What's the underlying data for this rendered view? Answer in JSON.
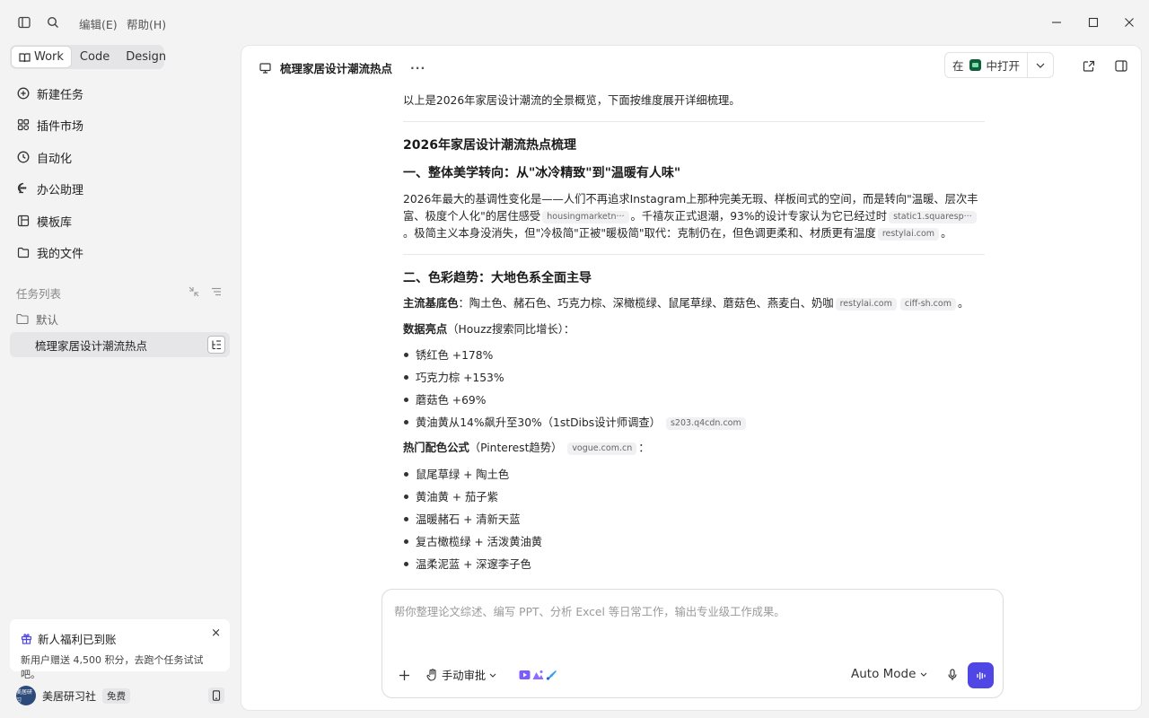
{
  "menu": {
    "edit": "编辑(E)",
    "help": "帮助(H)"
  },
  "modes": [
    {
      "label": "Work",
      "active": true
    },
    {
      "label": "Code",
      "active": false
    },
    {
      "label": "Design",
      "active": false
    }
  ],
  "nav": [
    {
      "label": "新建任务",
      "icon": "new-task-icon"
    },
    {
      "label": "插件市场",
      "icon": "plugin-icon"
    },
    {
      "label": "自动化",
      "icon": "clock-icon"
    },
    {
      "label": "办公助理",
      "icon": "chat-icon"
    },
    {
      "label": "模板库",
      "icon": "template-icon"
    },
    {
      "label": "我的文件",
      "icon": "folder-icon"
    }
  ],
  "tasks": {
    "section": "任务列表",
    "folder": "默认",
    "active_task": "梳理家居设计潮流热点"
  },
  "promo": {
    "title": "新人福利已到账",
    "subtitle": "新用户赠送 4,500 积分，去跑个任务试试吧。",
    "close": "×"
  },
  "user": {
    "name": "美居研习社",
    "plan": "免费",
    "avatar_text": "美居研习"
  },
  "header": {
    "title": "梳理家居设计潮流热点",
    "dots": "···",
    "open_prefix": "在",
    "open_label": "中打开"
  },
  "content": {
    "intro": "以上是2026年家居设计潮流的全景概览，下面按维度展开详细梳理。",
    "title": "2026年家居设计潮流热点梳理",
    "s1_heading": "一、整体美学转向：从\"冰冷精致\"到\"温暖有人味\"",
    "s1_p1": "2026年最大的基调性变化是——人们不再追求Instagram上那种完美无瑕、样板间式的空间，而是转向\"温暖、层次丰富、极度个人化\"的居住感受",
    "s1_cite1": "housingmarketn···",
    "s1_p2": "。千禧灰正式退潮，93%的设计专家认为它已经过时",
    "s1_cite2": "static1.squaresp···",
    "s1_p3": "。极简主义本身没消失，但\"冷极简\"正被\"暖极简\"取代：克制仍在，但色调更柔和、材质更有温度",
    "s1_cite3": "restylai.com",
    "s1_p4": "。",
    "s2_heading": "二、色彩趋势：大地色系全面主导",
    "base_label": "主流基底色",
    "base_text": "：陶土色、赭石色、巧克力棕、深橄榄绿、鼠尾草绿、蘑菇色、燕麦白、奶咖",
    "base_cite1": "restylai.com",
    "base_cite2": "ciff-sh.com",
    "base_end": "。",
    "data_label": "数据亮点",
    "data_text": "（Houzz搜索同比增长）：",
    "data_items": [
      "锈红色 +178%",
      "巧克力棕 +153%",
      "蘑菇色 +69%",
      "黄油黄从14%飙升至30%（1stDibs设计师调查）"
    ],
    "data_cite": "s203.q4cdn.com",
    "combo_label": "热门配色公式",
    "combo_text": "（Pinterest趋势）",
    "combo_cite": "vogue.com.cn",
    "combo_end": "：",
    "combo_items": [
      "鼠尾草绿 + 陶土色",
      "黄油黄 + 茄子紫",
      "温暖赭石 + 清新天蓝",
      "复古橄榄绿 + 活泼黄油黄",
      "温柔泥蓝 + 深邃李子色"
    ]
  },
  "composer": {
    "placeholder": "帮你整理论文综述、编写 PPT、分析 Excel 等日常工作，输出专业级工作成果。",
    "approve": "手动审批",
    "mode": "Auto Mode"
  },
  "colors": {
    "accent": "#4f46e5",
    "sidebar_bg": "#f3f3f4",
    "active_item": "#e6e6e8"
  }
}
